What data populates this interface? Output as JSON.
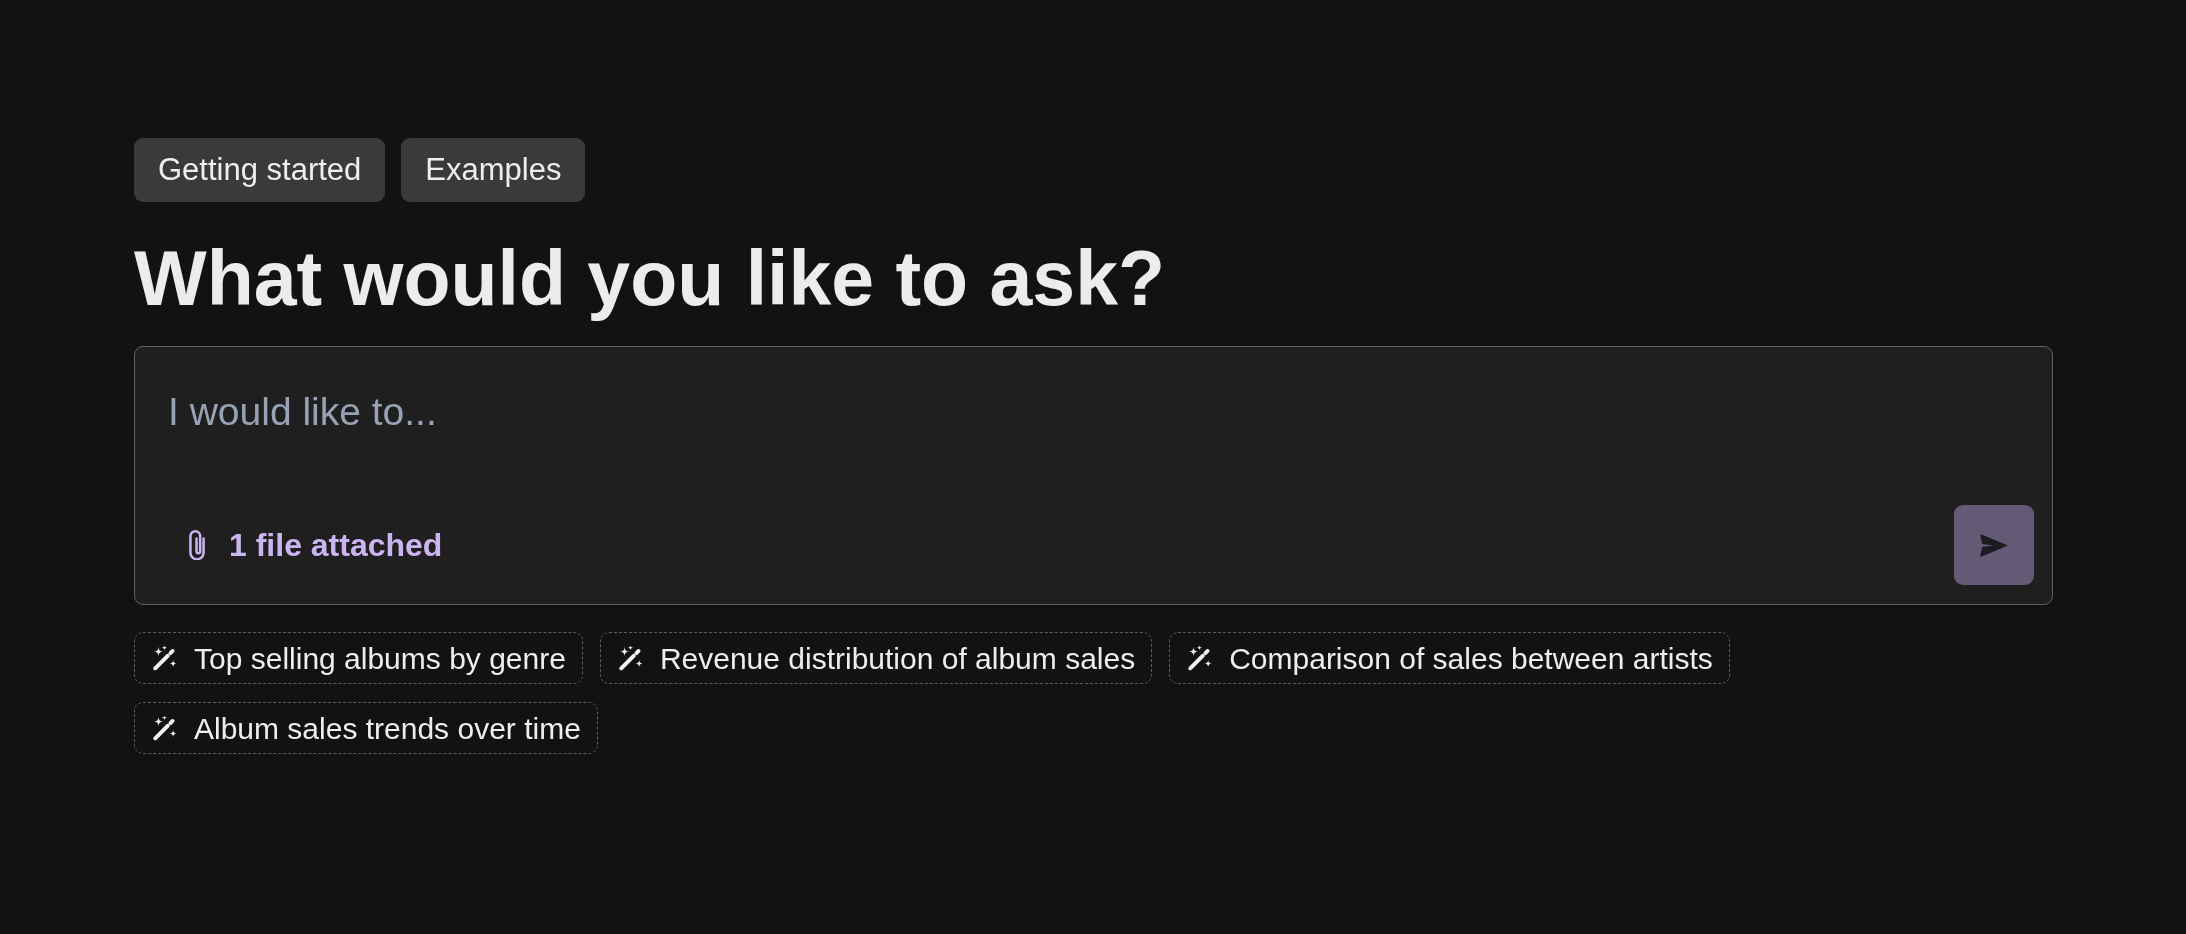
{
  "nav_buttons": [
    {
      "label": "Getting started"
    },
    {
      "label": "Examples"
    }
  ],
  "heading": "What would you like to ask?",
  "prompt": {
    "placeholder": "I would like to...",
    "attachment": "1 file attached"
  },
  "suggestions": [
    {
      "label": "Top selling albums by genre"
    },
    {
      "label": "Revenue distribution of album sales"
    },
    {
      "label": "Comparison of sales between artists"
    },
    {
      "label": "Album sales trends over time"
    }
  ]
}
